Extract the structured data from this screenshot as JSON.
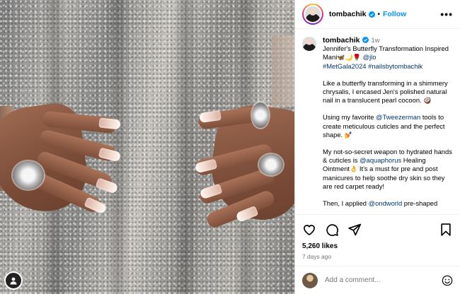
{
  "post": {
    "username": "tombachik",
    "follow_label": "Follow",
    "dot": "•",
    "more": "•••",
    "time_ago": "1w"
  },
  "caption": {
    "line1": "Jennifer's Butterfly Transformation Inspired Mani",
    "emojis1": "🦋🌙🌹",
    "mention_jlo": "@jlo",
    "hashtags": "#MetGala2024 #nailsbytombachik",
    "para2": "Like a butterfly transforming in a shimmery chrysalis, I encased Jen's polished natural nail in a translucent pearl cocoon.",
    "emoji2": "🥥",
    "para3_a": "Using my favorite ",
    "mention_tweezerman": "@Tweezerman",
    "para3_b": " tools to create meticulous cuticles and the perfect shape.",
    "emoji3": "💅",
    "para4_a": "My not-so-secret weapon to hydrated hands & cuticles is ",
    "mention_aquaphorus": "@aquaphorus",
    "para4_b": " Healing Ointment",
    "emoji4": "👌",
    "para4_c": " It's a must for pre and post manicures to help soothe dry skin so they are red carpet ready!",
    "para5_a": "Then, I applied ",
    "mention_ondworld": "@ondworld",
    "para5_b": " pre-shaped"
  },
  "stats": {
    "likes": "5,260 likes",
    "date": "7 days ago"
  },
  "comment": {
    "placeholder": "Add a comment..."
  },
  "colors": {
    "accent": "#0095f6",
    "link": "#00376b",
    "muted": "#737373"
  },
  "icons": [
    "heart-icon",
    "comment-icon",
    "share-icon",
    "bookmark-icon",
    "emoji-icon",
    "more-icon",
    "verified-icon"
  ]
}
